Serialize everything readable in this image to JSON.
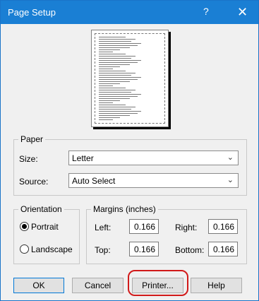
{
  "title_bar": {
    "title": "Page Setup",
    "help_glyph": "?",
    "close_glyph": "✕"
  },
  "paper": {
    "legend": "Paper",
    "size_label": "Size:",
    "size_value": "Letter",
    "source_label": "Source:",
    "source_value": "Auto Select",
    "chevron": "⌄"
  },
  "orientation": {
    "legend": "Orientation",
    "options": [
      {
        "label": "Portrait",
        "checked": true
      },
      {
        "label": "Landscape",
        "checked": false
      }
    ]
  },
  "margins": {
    "legend": "Margins (inches)",
    "left_label": "Left:",
    "left_value": "0.166",
    "right_label": "Right:",
    "right_value": "0.166",
    "top_label": "Top:",
    "top_value": "0.166",
    "bottom_label": "Bottom:",
    "bottom_value": "0.166"
  },
  "buttons": {
    "ok": "OK",
    "cancel": "Cancel",
    "printer": "Printer...",
    "help": "Help"
  },
  "colors": {
    "title_bar": "#1a7fd4",
    "highlight": "#d11a1a",
    "dialog_bg": "#f0f0f0"
  },
  "icons": [
    "help-icon",
    "close-icon",
    "dropdown-chevron-icon",
    "page-preview-icon"
  ]
}
